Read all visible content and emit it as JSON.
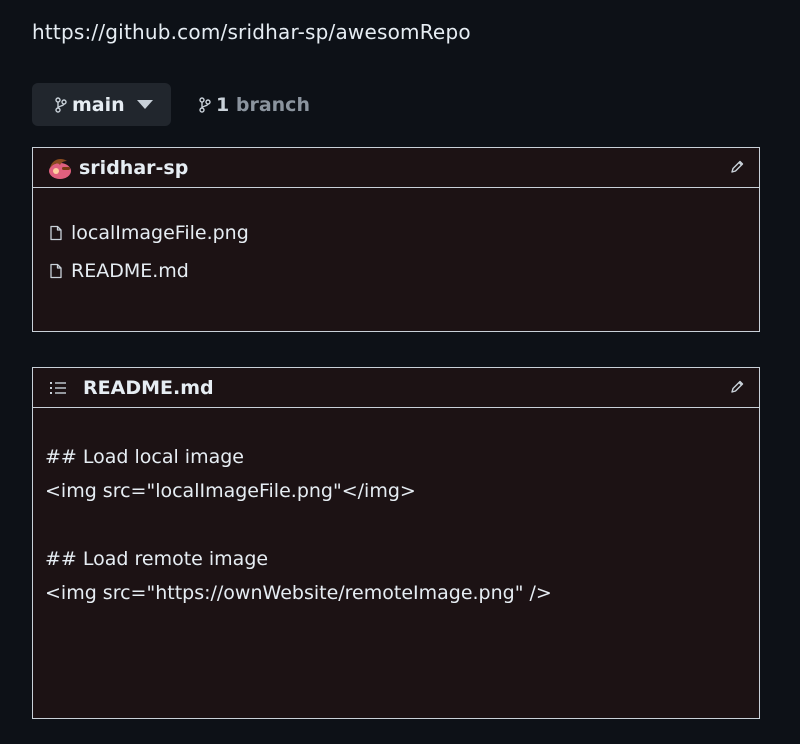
{
  "repo_url": "https://github.com/sridhar-sp/awesomRepo",
  "branch": {
    "selected": "main",
    "count_number": "1",
    "count_word": "branch"
  },
  "files_panel": {
    "owner": "sridhar-sp",
    "files": [
      {
        "name": "localImageFile.png",
        "icon": "file-icon"
      },
      {
        "name": "README.md",
        "icon": "file-icon"
      }
    ]
  },
  "readme_panel": {
    "title": "README.md",
    "lines": [
      "## Load local image",
      "<img src=\"localImageFile.png\"</img>",
      "",
      "## Load remote image",
      "<img src=\"https://ownWebsite/remoteImage.png\" />"
    ]
  },
  "colors": {
    "background": "#0d1117",
    "panel_background": "#1c1214",
    "panel_border": "#c9d1d9",
    "button_background": "#21262d",
    "muted_text": "#8b949e"
  }
}
